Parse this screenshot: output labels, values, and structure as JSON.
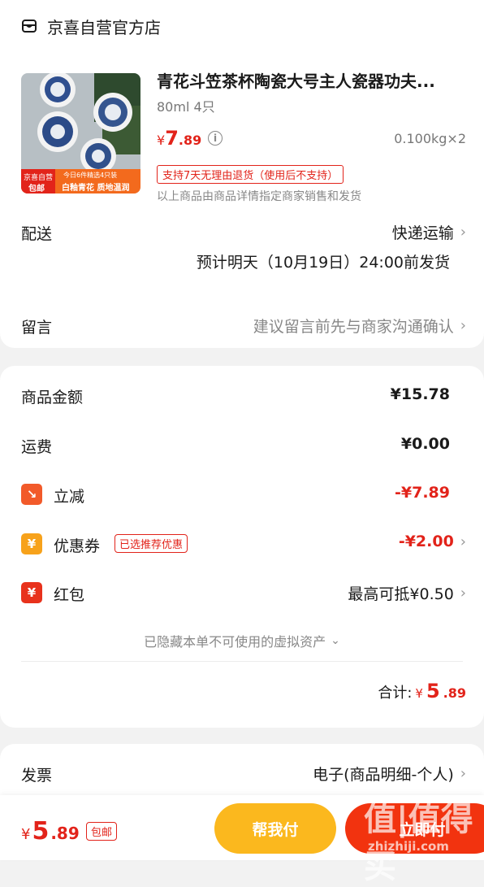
{
  "shop": {
    "name": "京喜自营官方店"
  },
  "product": {
    "title": "青花斗笠茶杯陶瓷大号主人瓷器功夫...",
    "spec": "80ml 4只",
    "price_currency": "¥",
    "price_int": "7",
    "price_dec": ".89",
    "weight": "0.100kg×2",
    "return_tag": "支持7天无理由退货（使用后不支持）",
    "seller_note": "以上商品由商品详情指定商家销售和发货",
    "thumb_badge_top": "京喜自营",
    "thumb_badge_bottom": "包邮",
    "thumb_banner_top": "今日6件精选4只装",
    "thumb_banner_bottom": "白釉青花 质地温润"
  },
  "delivery": {
    "label": "配送",
    "method": "快递运输",
    "estimate": "预计明天（10月19日）24:00前发货"
  },
  "message": {
    "label": "留言",
    "placeholder": "建议留言前先与商家沟通确认"
  },
  "summary": {
    "goods_label": "商品金额",
    "goods_value": "¥15.78",
    "shipping_label": "运费",
    "shipping_value": "¥0.00",
    "discount_label": "立减",
    "discount_value": "-¥7.89",
    "coupon_label": "优惠券",
    "coupon_tag": "已选推荐优惠",
    "coupon_value": "-¥2.00",
    "redpacket_label": "红包",
    "redpacket_value": "最高可抵¥0.50",
    "hidden_assets": "已隐藏本单不可使用的虚拟资产",
    "total_label": "合计:",
    "total_currency": "¥",
    "total_int": "5",
    "total_dec": ".89"
  },
  "invoice": {
    "label": "发票",
    "value": "电子(商品明细-个人)"
  },
  "bottom_bar": {
    "currency": "¥",
    "price_int": "5",
    "price_dec": ".89",
    "free_ship": "包邮",
    "help_pay": "帮我付",
    "pay_now": "立即付"
  },
  "watermark": {
    "brand": "值|值得买",
    "url": "zhizhiji.com"
  },
  "colors": {
    "accent": "#e2231a",
    "yellow": "#fbb81e",
    "orange_red": "#f2330f"
  }
}
